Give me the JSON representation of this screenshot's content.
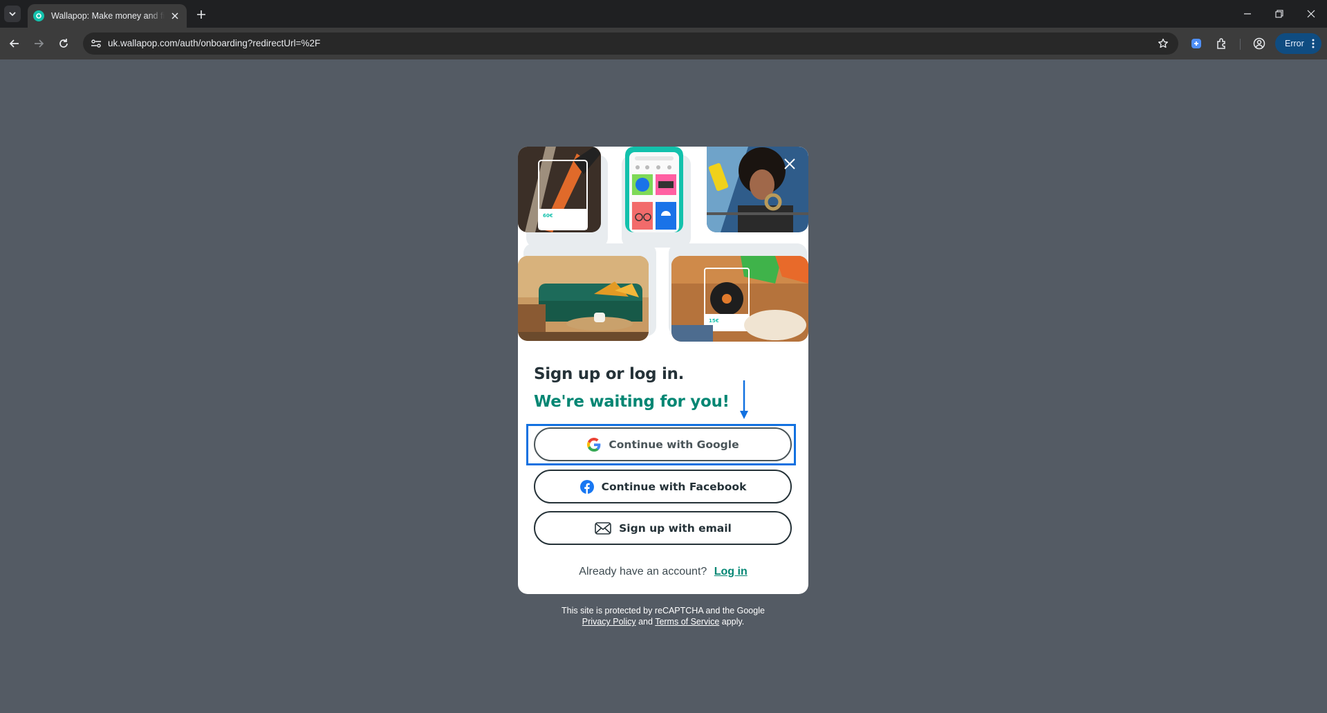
{
  "browser": {
    "tab_title": "Wallapop: Make money and find",
    "url": "uk.wallapop.com/auth/onboarding?redirectUrl=%2F",
    "profile_button_label": "Error"
  },
  "modal": {
    "heading": "Sign up or log in.",
    "subheading": "We're waiting for you!",
    "buttons": {
      "google": "Continue with Google",
      "facebook": "Continue with Facebook",
      "email": "Sign up with email"
    },
    "account_prompt": "Already have an account?",
    "login_link": "Log in",
    "photo_labels": {
      "skateboard_price": "60€",
      "vinyl_price": "15€"
    }
  },
  "recaptcha": {
    "line1": "This site is protected by reCAPTCHA and the Google",
    "privacy": "Privacy Policy",
    "and": "and",
    "terms": "Terms of Service",
    "apply": "apply."
  },
  "colors": {
    "brand_teal": "#038673",
    "brand_accent": "#13c1ac",
    "text_dark": "#253238",
    "highlight_blue": "#1271e0",
    "page_overlay": "#545b64"
  }
}
